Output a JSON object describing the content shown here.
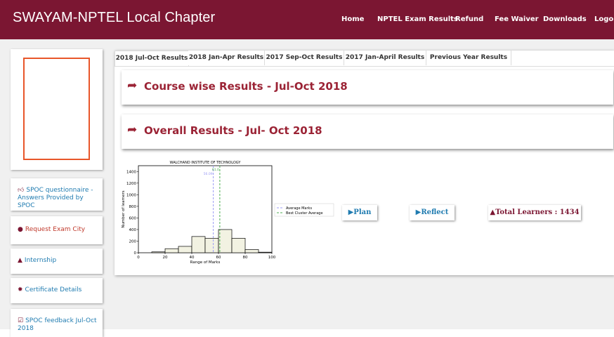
{
  "header": {
    "brand": "SWAYAM-NPTEL Local Chapter",
    "nav": [
      "Home",
      "NPTEL Exam Results",
      "Refund",
      "Fee Waiver",
      "Downloads",
      "Logout"
    ]
  },
  "sidebar": {
    "links": [
      {
        "label": "SPOC questionnaire - Answers Provided by SPOC",
        "icon": "thumbs-up-icon"
      },
      {
        "label": "Request Exam City",
        "icon": "map-marker-icon"
      },
      {
        "label": "Internship",
        "icon": "graduation-cap-icon"
      },
      {
        "label": "Certificate Details",
        "icon": "certificate-icon"
      },
      {
        "label": "SPOC feedback Jul-Oct 2018",
        "icon": "calendar-check-icon"
      }
    ]
  },
  "tabs": [
    "2018 Jul-Oct Results",
    "2018 Jan-Apr Results",
    "2017 Sep-Oct Results",
    "2017 Jan-April Results",
    "Previous Year Results"
  ],
  "sections": {
    "course_wise": "Course wise Results - Jul-Oct 2018",
    "overall": "Overall Results - Jul- Oct 2018"
  },
  "buttons": {
    "plan": "▶Plan",
    "reflect": "▶Reflect",
    "total_learners": "Total Learners : 1434"
  },
  "colors": {
    "brand": "#7b1632",
    "accent_red": "#9b2335",
    "link_blue": "#1f7bb0",
    "histogram_fill": "#f2f2e2"
  },
  "chart_data": {
    "type": "bar",
    "title": "WALCHAND INSTITUTE OF TECHNOLOGY",
    "xlabel": "Range of Marks",
    "ylabel": "Number of learners",
    "bins": [
      [
        10,
        20
      ],
      [
        20,
        30
      ],
      [
        30,
        40
      ],
      [
        40,
        50
      ],
      [
        50,
        60
      ],
      [
        60,
        70
      ],
      [
        70,
        80
      ],
      [
        80,
        90
      ],
      [
        90,
        100
      ]
    ],
    "values": [
      15,
      70,
      110,
      280,
      250,
      400,
      250,
      55,
      10
    ],
    "xlim": [
      0,
      100
    ],
    "ylim": [
      0,
      1500
    ],
    "xticks": [
      0,
      20,
      40,
      60,
      80,
      100
    ],
    "yticks": [
      0,
      200,
      400,
      600,
      800,
      1000,
      1200,
      1400
    ],
    "vlines": [
      {
        "name": "Average Marks",
        "x": 56.09,
        "color": "#9b9bf5",
        "label": "56.09"
      },
      {
        "name": "Best Cluster Average",
        "x": 61.0,
        "color": "#4caf50",
        "label": "61.0"
      }
    ],
    "legend": "right"
  }
}
